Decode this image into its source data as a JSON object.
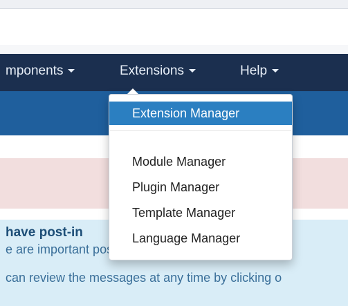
{
  "navbar": {
    "items": [
      {
        "label": "mponents"
      },
      {
        "label": "Extensions"
      },
      {
        "label": "Help"
      }
    ]
  },
  "dropdown": {
    "items": [
      {
        "label": "Extension Manager",
        "active": true
      },
      {
        "label": "Module Manager"
      },
      {
        "label": "Plugin Manager"
      },
      {
        "label": "Template Manager"
      },
      {
        "label": "Language Manager"
      }
    ]
  },
  "info": {
    "title": "have post-in",
    "line1": "e are important post-installation messages that r",
    "line2": "can review the messages at any time by clicking o"
  },
  "colors": {
    "navbar_bg": "#1b2f4f",
    "subnav_bg": "#1f5f9d",
    "active_item_bg": "#2b7fc1",
    "error_bg": "#f2dede",
    "info_bg": "#d9edf7"
  }
}
